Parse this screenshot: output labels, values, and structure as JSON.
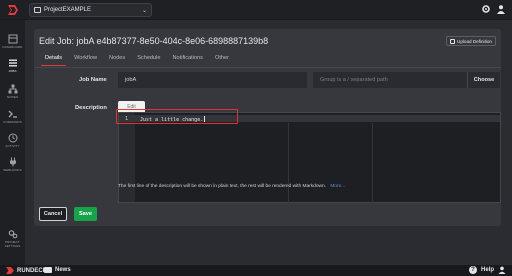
{
  "topbar": {
    "project": "ProjectEXAMPLE"
  },
  "sidebar": {
    "items": [
      {
        "label": "DASHBOARD",
        "icon": "dashboard-icon"
      },
      {
        "label": "JOBS",
        "icon": "jobs-icon"
      },
      {
        "label": "NODES",
        "icon": "nodes-icon"
      },
      {
        "label": "COMMANDS",
        "icon": "commands-icon"
      },
      {
        "label": "ACTIVITY",
        "icon": "activity-icon"
      },
      {
        "label": "WEBHOOKS",
        "icon": "webhooks-icon"
      },
      {
        "label": "PROJECT",
        "icon": "gear-icon"
      },
      {
        "label": "SETTINGS",
        "icon": ""
      }
    ]
  },
  "page": {
    "title": "Edit Job: jobA e4b87377-8e50-404c-8e06-6898887139b8",
    "upload_label": "Upload Definition"
  },
  "tabs": [
    "Details",
    "Workflow",
    "Nodes",
    "Schedule",
    "Notifications",
    "Other"
  ],
  "form": {
    "job_name_label": "Job Name",
    "job_name_value": "jobA",
    "group_placeholder": "Group is a / separated path",
    "choose_label": "Choose",
    "description_label": "Description",
    "edit_tab_label": "Edit",
    "line_number": "1",
    "description_text": "Just a little change.",
    "help_text": "The first line of the description will be shown in plain text, the rest will be rendered with Markdown.",
    "more_label": "More..."
  },
  "actions": {
    "cancel": "Cancel",
    "save": "Save"
  },
  "bottombar": {
    "brand": "RUNDECK",
    "news": "News",
    "help": "Help",
    "help_q": "?"
  },
  "colors": {
    "accent_red": "#e03b3b",
    "save_green": "#17a34a",
    "link_blue": "#5b8ed9"
  }
}
